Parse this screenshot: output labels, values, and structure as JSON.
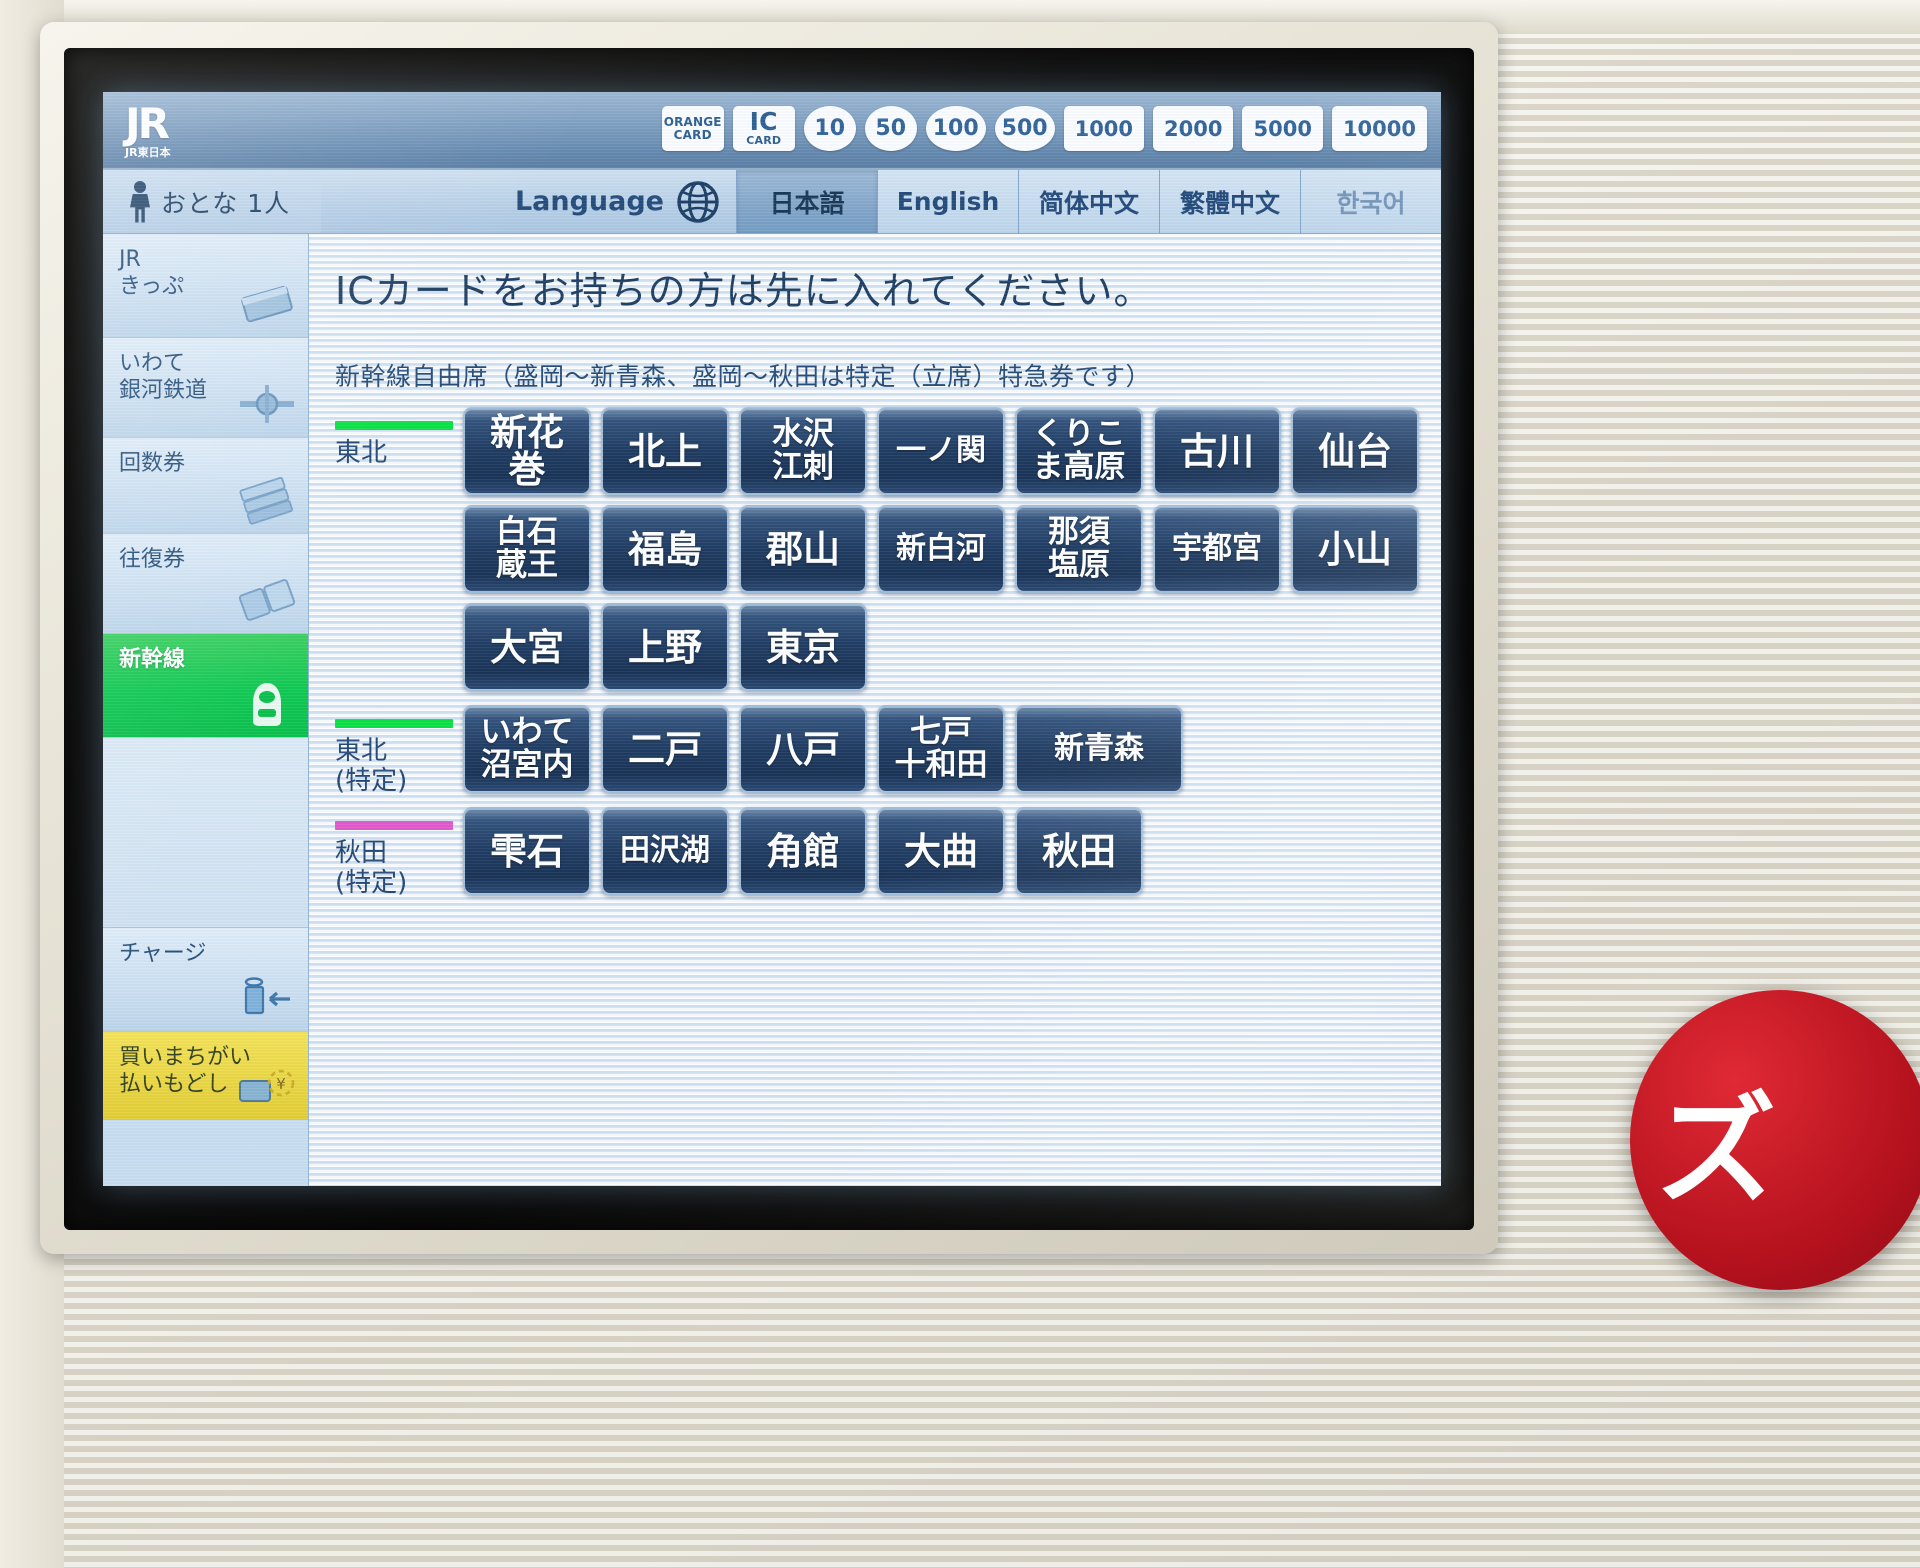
{
  "header": {
    "logo_text": "JR",
    "logo_sub": "JR東日本",
    "cards": [
      {
        "line1": "ORANGE",
        "line2": "CARD",
        "name": "orange-card"
      },
      {
        "line1": "IC",
        "line2": "CARD",
        "name": "ic-card"
      }
    ],
    "coins": [
      "10",
      "50",
      "100",
      "500"
    ],
    "notes": [
      "1000",
      "2000",
      "5000",
      "10000"
    ]
  },
  "passenger": {
    "label": "おとな 1人"
  },
  "language": {
    "label": "Language",
    "tabs": [
      {
        "label": "日本語",
        "selected": true,
        "dim": false
      },
      {
        "label": "English",
        "selected": false,
        "dim": false
      },
      {
        "label": "简体中文",
        "selected": false,
        "dim": false
      },
      {
        "label": "繁體中文",
        "selected": false,
        "dim": false
      },
      {
        "label": "한국어",
        "selected": false,
        "dim": true
      }
    ]
  },
  "sidebar": {
    "items": [
      {
        "label": "JR\nきっぷ",
        "icon": "ticket-card-icon",
        "state": "normal",
        "height": "h104"
      },
      {
        "label": "いわて\n銀河鉄道",
        "icon": "railway-line-icon",
        "state": "normal",
        "height": "h100"
      },
      {
        "label": "回数券",
        "icon": "coupon-stack-icon",
        "state": "normal",
        "height": "h96"
      },
      {
        "label": "往復券",
        "icon": "round-trip-icon",
        "state": "normal",
        "height": "h100"
      },
      {
        "label": "新幹線",
        "icon": "shinkansen-icon",
        "state": "selected",
        "height": "h104"
      },
      {
        "label": "",
        "icon": "",
        "state": "blank",
        "height": "h190"
      },
      {
        "label": "チャージ",
        "icon": "charge-icon",
        "state": "normal",
        "height": "h104"
      },
      {
        "label": "買いまちがい\n払いもどし",
        "icon": "refund-icon",
        "state": "warn",
        "height": "h88"
      }
    ]
  },
  "main": {
    "headline": "ICカードをお持ちの方は先に入れてください。",
    "subnote": "新幹線自由席（盛岡〜新青森、盛岡〜秋田は特定（立席）特急券です）",
    "groups": [
      {
        "label": "東北",
        "line_color": "#00e03c",
        "rows": [
          [
            {
              "label": "新花巻",
              "lines": 1
            },
            {
              "label": "北上",
              "lines": 1
            },
            {
              "label": "水沢\n江刺",
              "lines": 2
            },
            {
              "label": "一ノ関",
              "lines": 1
            },
            {
              "label": "くりこ\nま高原",
              "lines": 2
            },
            {
              "label": "古川",
              "lines": 1
            },
            {
              "label": "仙台",
              "lines": 1
            }
          ],
          [
            {
              "label": "白石\n蔵王",
              "lines": 2
            },
            {
              "label": "福島",
              "lines": 1
            },
            {
              "label": "郡山",
              "lines": 1
            },
            {
              "label": "新白河",
              "lines": 1
            },
            {
              "label": "那須\n塩原",
              "lines": 2
            },
            {
              "label": "宇都宮",
              "lines": 1
            },
            {
              "label": "小山",
              "lines": 1
            }
          ],
          [
            {
              "label": "大宮",
              "lines": 1
            },
            {
              "label": "上野",
              "lines": 1
            },
            {
              "label": "東京",
              "lines": 1
            }
          ]
        ]
      },
      {
        "label": "東北\n(特定)",
        "line_color": "#00e03c",
        "rows": [
          [
            {
              "label": "いわて\n沼宮内",
              "lines": 2
            },
            {
              "label": "二戸",
              "lines": 1
            },
            {
              "label": "八戸",
              "lines": 1
            },
            {
              "label": "七戸\n十和田",
              "lines": 2
            },
            {
              "label": "新青森",
              "lines": 1
            }
          ]
        ]
      },
      {
        "label": "秋田\n(特定)",
        "line_color": "#e152c8",
        "rows": [
          [
            {
              "label": "雫石",
              "lines": 1
            },
            {
              "label": "田沢湖",
              "lines": 1
            },
            {
              "label": "角館",
              "lines": 1
            },
            {
              "label": "大曲",
              "lines": 1
            },
            {
              "label": "秋田",
              "lines": 1
            }
          ]
        ]
      }
    ]
  },
  "overlay": {
    "red_sign_text": "ズ"
  },
  "colors": {
    "selected_green": "#01be44",
    "warn_yellow": "#ecd63c",
    "tohoku_line": "#00e03c",
    "akita_line": "#e152c8",
    "button_navy": "#17345b",
    "header_blue": "#7b9cbe"
  }
}
